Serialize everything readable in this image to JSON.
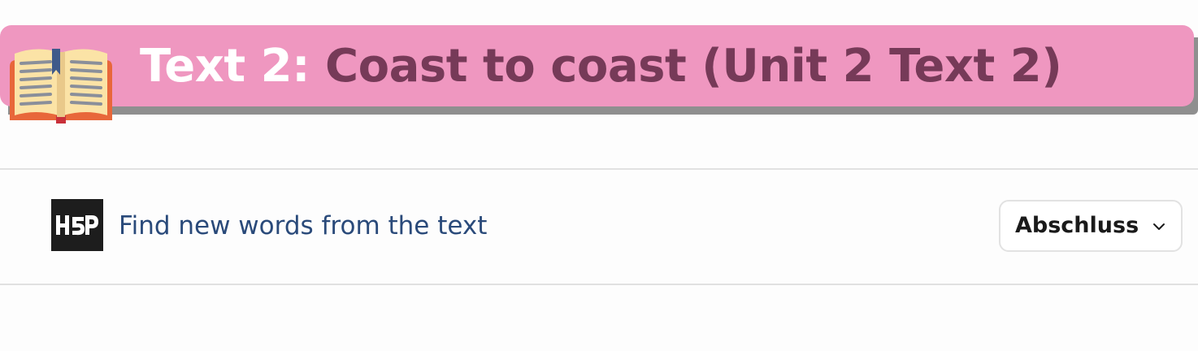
{
  "section": {
    "title_prefix": "Text 2:",
    "title_main": "Coast to coast (Unit 2 Text 2)",
    "banner_color": "#ef97c0",
    "title_main_color": "#763a58",
    "icon": "open-book-icon"
  },
  "activity": {
    "icon": "h5p-icon",
    "link_text": "Find new words from the text",
    "link_color": "#2a4a7a",
    "completion": {
      "label": "Abschluss",
      "icon": "chevron-down-icon"
    }
  }
}
